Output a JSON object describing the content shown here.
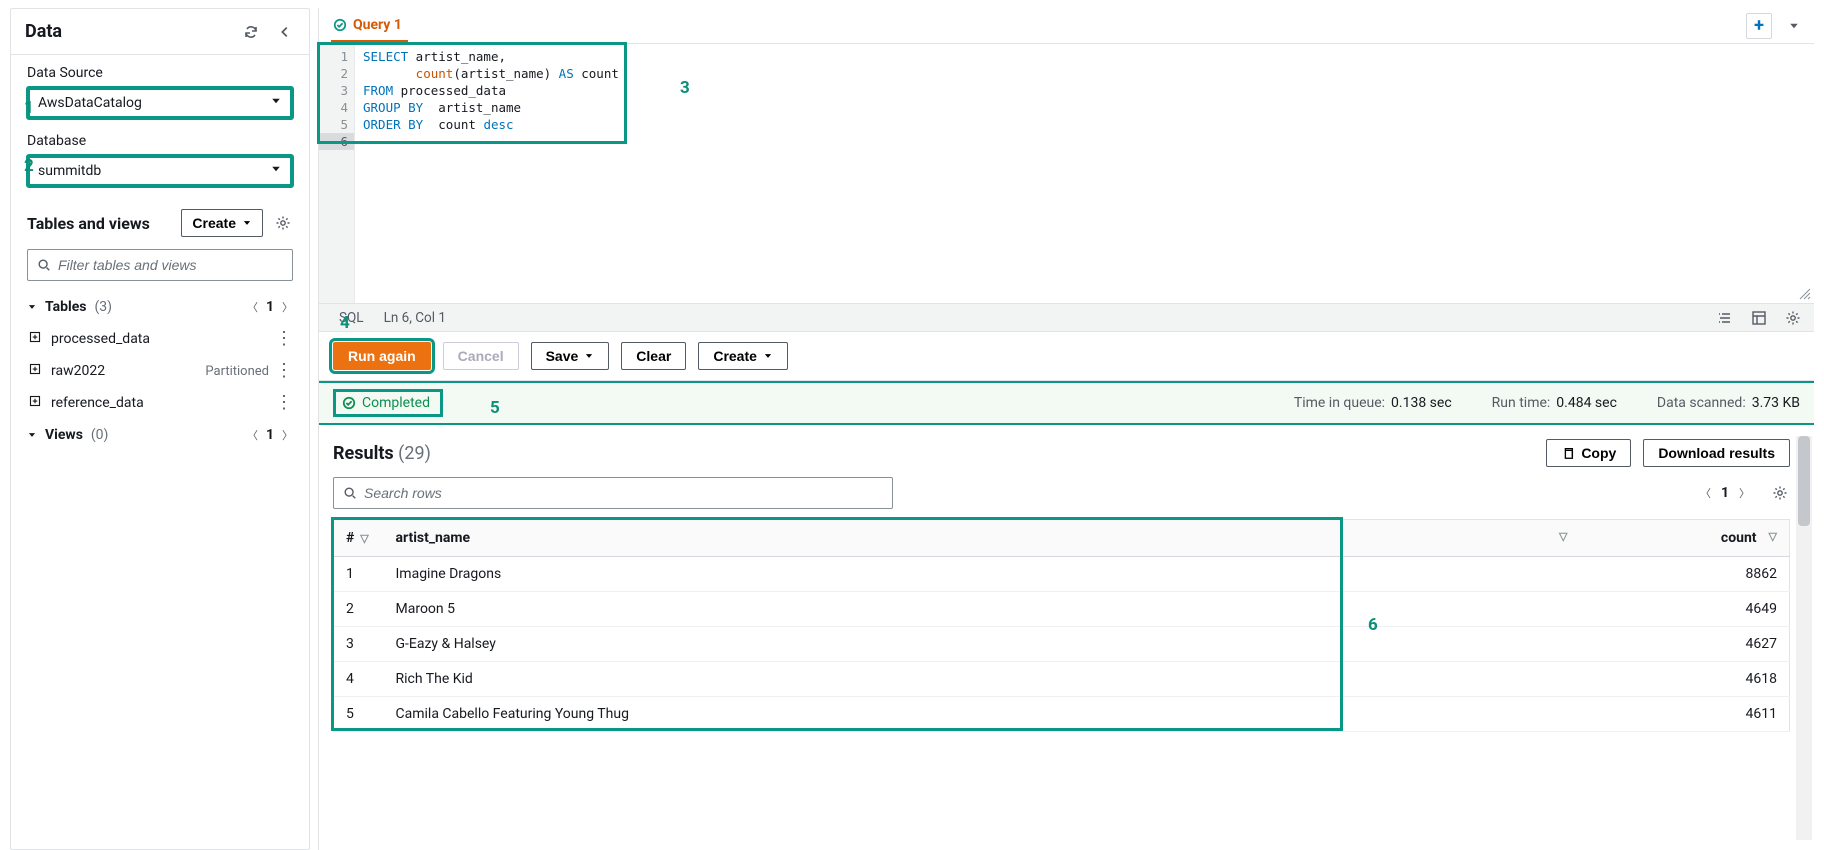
{
  "annotations": {
    "1": "1",
    "2": "2",
    "3": "3",
    "4": "4",
    "5": "5",
    "6": "6"
  },
  "sidebar": {
    "title": "Data",
    "data_source_label": "Data Source",
    "data_source_value": "AwsDataCatalog",
    "database_label": "Database",
    "database_value": "summitdb",
    "tables_views_title": "Tables and views",
    "create_label": "Create",
    "filter_placeholder": "Filter tables and views",
    "tables_label": "Tables",
    "tables_count": "(3)",
    "tables_page": "1",
    "views_label": "Views",
    "views_count": "(0)",
    "views_page": "1",
    "tables": [
      {
        "name": "processed_data",
        "tag": ""
      },
      {
        "name": "raw2022",
        "tag": "Partitioned"
      },
      {
        "name": "reference_data",
        "tag": ""
      }
    ]
  },
  "tabs": {
    "query1": "Query 1"
  },
  "editor": {
    "lines": [
      "1",
      "2",
      "3",
      "4",
      "5",
      "6"
    ],
    "l1a": "SELECT",
    "l1b": " artist_name,",
    "l2a": "       count",
    "l2b": "(artist_name) ",
    "l2c": "AS",
    "l2d": " count",
    "l3a": "FROM",
    "l3b": " processed_data",
    "l4a": "GROUP BY",
    "l4b": "  artist_name",
    "l5a": "ORDER BY",
    "l5b": "  count ",
    "l5c": "desc"
  },
  "statusbar": {
    "lang": "SQL",
    "pos": "Ln 6, Col 1"
  },
  "actions": {
    "run": "Run again",
    "cancel": "Cancel",
    "save": "Save",
    "clear": "Clear",
    "create": "Create"
  },
  "completed": {
    "label": "Completed",
    "queue_label": "Time in queue:",
    "queue_val": "0.138 sec",
    "runtime_label": "Run time:",
    "runtime_val": "0.484 sec",
    "scanned_label": "Data scanned:",
    "scanned_val": "3.73 KB"
  },
  "results": {
    "title": "Results",
    "count": "(29)",
    "copy": "Copy",
    "download": "Download results",
    "search_placeholder": "Search rows",
    "page": "1",
    "col_idx": "#",
    "col_artist": "artist_name",
    "col_count": "count",
    "rows": [
      {
        "i": "1",
        "artist": "Imagine Dragons",
        "count": "8862"
      },
      {
        "i": "2",
        "artist": "Maroon 5",
        "count": "4649"
      },
      {
        "i": "3",
        "artist": "G-Eazy & Halsey",
        "count": "4627"
      },
      {
        "i": "4",
        "artist": "Rich The Kid",
        "count": "4618"
      },
      {
        "i": "5",
        "artist": "Camila Cabello Featuring Young Thug",
        "count": "4611"
      }
    ]
  }
}
